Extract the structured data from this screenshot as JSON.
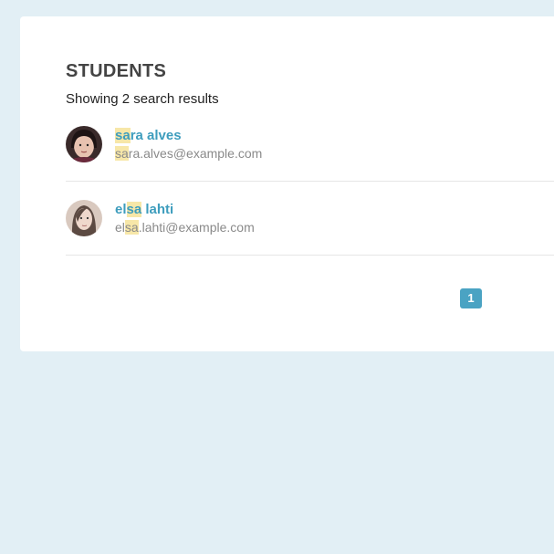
{
  "header": {
    "title": "STUDENTS",
    "summary": "Showing 2 search results"
  },
  "search": {
    "query": "sa"
  },
  "students": [
    {
      "name_hl": "sa",
      "name_rest": "ra alves",
      "email_pre": "",
      "email_hl": "sa",
      "email_rest": "ra.alves@example.com",
      "avatar": "user-avatar-dark-hair"
    },
    {
      "name_pre": "el",
      "name_hl": "sa",
      "name_rest": " lahti",
      "email_pre": "el",
      "email_hl": "sa",
      "email_rest": ".lahti@example.com",
      "avatar": "user-avatar-long-hair"
    }
  ],
  "pagination": {
    "current_page": "1"
  },
  "colors": {
    "background": "#e2eff5",
    "card": "#ffffff",
    "accent": "#3e9dbd",
    "highlight": "#f7e7a8",
    "page_button": "#4aa3c3"
  }
}
